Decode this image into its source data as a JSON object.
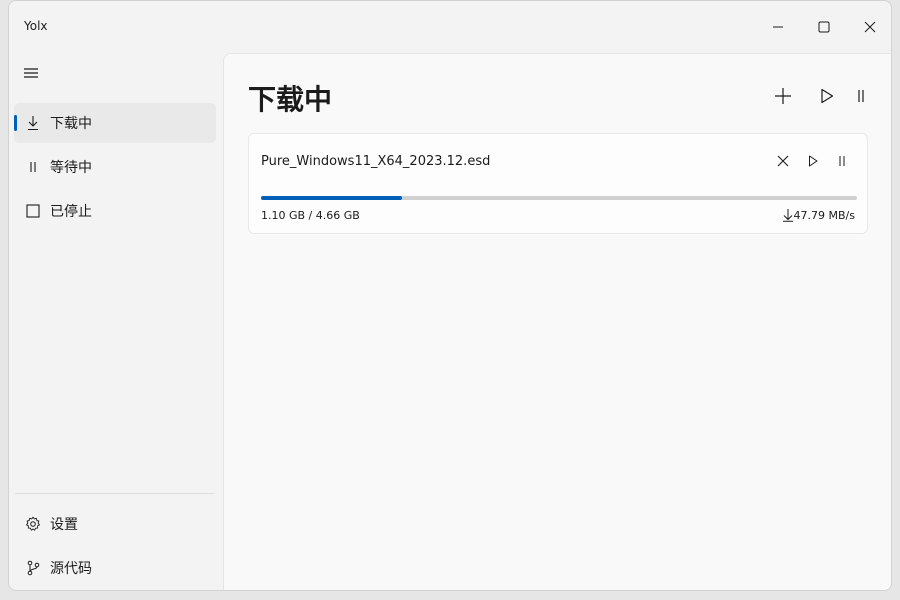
{
  "window": {
    "title": "Yolx"
  },
  "sidebar": {
    "items": [
      {
        "label": "下载中",
        "icon": "download-icon",
        "selected": true
      },
      {
        "label": "等待中",
        "icon": "pause-icon",
        "selected": false
      },
      {
        "label": "已停止",
        "icon": "stop-square-icon",
        "selected": false
      }
    ],
    "footer": [
      {
        "label": "设置",
        "icon": "gear-icon"
      },
      {
        "label": "源代码",
        "icon": "branch-icon"
      }
    ]
  },
  "main": {
    "title": "下载中",
    "downloads": [
      {
        "file_name": "Pure_Windows11_X64_2023.12.esd",
        "size_text": "1.10 GB / 4.66 GB",
        "speed": "47.79 MB/s",
        "progress": 0.236
      }
    ]
  },
  "colors": {
    "accent": "#005fb8",
    "track": "#d0d0d0"
  }
}
